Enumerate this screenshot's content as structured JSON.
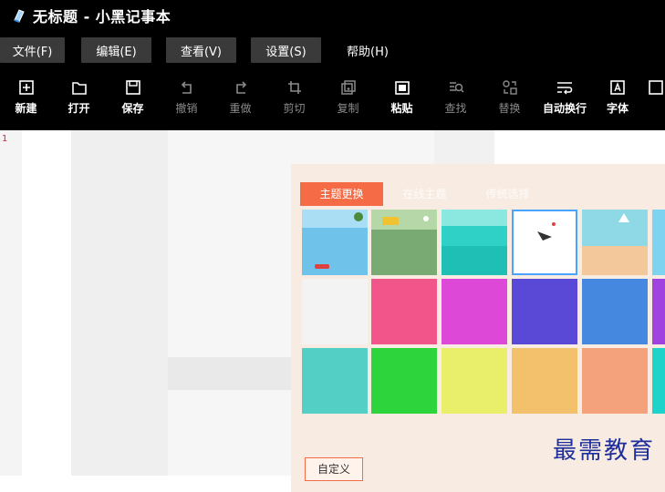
{
  "window": {
    "title": "无标题 - 小黑记事本"
  },
  "menu": [
    {
      "label": "文件(F)"
    },
    {
      "label": "编辑(E)"
    },
    {
      "label": "查看(V)"
    },
    {
      "label": "设置(S)"
    },
    {
      "label": "帮助(H)"
    }
  ],
  "toolbar": [
    {
      "label": "新建",
      "icon": "new-file-icon",
      "enabled": true
    },
    {
      "label": "打开",
      "icon": "open-folder-icon",
      "enabled": true
    },
    {
      "label": "保存",
      "icon": "save-icon",
      "enabled": true
    },
    {
      "label": "撤销",
      "icon": "undo-icon",
      "enabled": false
    },
    {
      "label": "重做",
      "icon": "redo-icon",
      "enabled": false
    },
    {
      "label": "剪切",
      "icon": "cut-icon",
      "enabled": false
    },
    {
      "label": "复制",
      "icon": "copy-icon",
      "enabled": false
    },
    {
      "label": "粘贴",
      "icon": "paste-icon",
      "enabled": true
    },
    {
      "label": "查找",
      "icon": "find-icon",
      "enabled": false
    },
    {
      "label": "替换",
      "icon": "replace-icon",
      "enabled": false
    },
    {
      "label": "自动换行",
      "icon": "word-wrap-icon",
      "enabled": true
    },
    {
      "label": "字体",
      "icon": "font-icon",
      "enabled": true
    }
  ],
  "editor": {
    "line_number": "1"
  },
  "theme_dialog": {
    "tabs": [
      {
        "label": "主题更换",
        "active": true
      },
      {
        "label": "在线主题",
        "active": false
      },
      {
        "label": "传统选择",
        "active": false
      }
    ],
    "swatches": [
      {
        "color": "#6fc3ea",
        "kind": "scene-sky"
      },
      {
        "color": "#7aaa73",
        "kind": "scene-bus"
      },
      {
        "color": "#2fd0c6",
        "kind": "scene-teal"
      },
      {
        "color": "#ffffff",
        "kind": "scene-white",
        "selected": true
      },
      {
        "color": "#f3c89a",
        "kind": "scene-beach"
      },
      {
        "color": "#7ed3f0",
        "kind": "scene-cut"
      },
      {
        "color": "#f3f3f3"
      },
      {
        "color": "#f2558a"
      },
      {
        "color": "#dd48d6"
      },
      {
        "color": "#5a48d6"
      },
      {
        "color": "#4488e0"
      },
      {
        "color": "#a042e0"
      },
      {
        "color": "#54cfc5"
      },
      {
        "color": "#2ed43c"
      },
      {
        "color": "#e9ef6b"
      },
      {
        "color": "#f3c16b"
      },
      {
        "color": "#f3a27b"
      },
      {
        "color": "#1ed4ca"
      }
    ],
    "custom_label": "自定义"
  },
  "watermark": "最需教育",
  "accent": "#f46b45"
}
